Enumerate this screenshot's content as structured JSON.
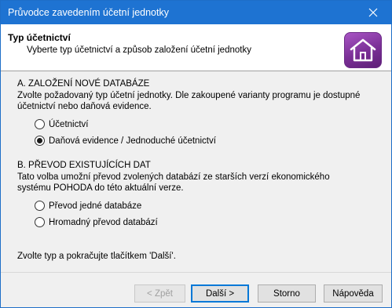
{
  "window": {
    "title": "Průvodce zavedením účetní jednotky",
    "close_icon": "close-icon"
  },
  "header": {
    "title": "Typ účetnictví",
    "subtitle": "Vyberte typ účetnictví a způsob založení účetní jednotky",
    "logo_icon": "home-icon",
    "logo_color": "#8a3aa8"
  },
  "section_a": {
    "title": "A. ZALOŽENÍ NOVÉ DATABÁZE",
    "description": "Zvolte požadovaný typ účetní jednotky. Dle zakoupené varianty programu je dostupné účetnictví nebo daňová evidence.",
    "options": [
      {
        "label": "Účetnictví",
        "selected": false
      },
      {
        "label": "Daňová evidence / Jednoduché účetnictví",
        "selected": true
      }
    ]
  },
  "section_b": {
    "title": "B. PŘEVOD EXISTUJÍCÍCH DAT",
    "description": "Tato volba umožní převod zvolených databází ze starších verzí ekonomického systému POHODA do této aktuální verze.",
    "options": [
      {
        "label": "Převod jedné databáze",
        "selected": false
      },
      {
        "label": "Hromadný převod databází",
        "selected": false
      }
    ]
  },
  "hint": "Zvolte typ a pokračujte tlačítkem 'Další'.",
  "buttons": {
    "back": "< Zpět",
    "next": "Další >",
    "cancel": "Storno",
    "help": "Nápověda"
  }
}
